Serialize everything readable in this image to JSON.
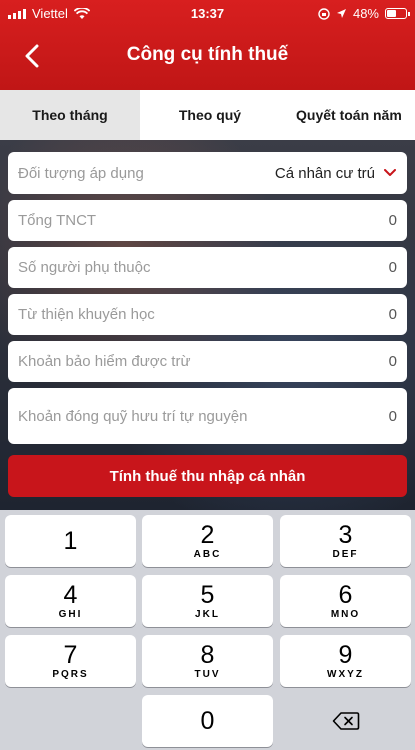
{
  "status_bar": {
    "carrier": "Viettel",
    "time": "13:37",
    "battery": "48%"
  },
  "header": {
    "title": "Công cụ tính thuế",
    "back_icon": "chevron-left-icon"
  },
  "tabs": [
    {
      "label": "Theo tháng",
      "active": true
    },
    {
      "label": "Theo quý",
      "active": false
    },
    {
      "label": "Quyết toán năm",
      "active": false
    }
  ],
  "form": {
    "applicable_subject": {
      "label": "Đối tượng áp dụng",
      "value": "Cá nhân cư trú"
    },
    "total_income": {
      "placeholder": "Tổng TNCT",
      "value": "0"
    },
    "dependents": {
      "placeholder": "Số người phụ thuộc",
      "value": "0"
    },
    "charity": {
      "placeholder": "Từ thiện khuyến học",
      "value": "0"
    },
    "insurance": {
      "placeholder": "Khoản bảo hiểm được trừ",
      "value": "0"
    },
    "pension": {
      "placeholder": "Khoản đóng quỹ hưu trí tự nguyện",
      "value": "0"
    },
    "calculate_button": "Tính thuế thu nhập cá nhân"
  },
  "colors": {
    "brand_red": "#c8151b",
    "header_red": "#d81f1f"
  },
  "keyboard": {
    "keys": [
      {
        "num": "1",
        "letters": ""
      },
      {
        "num": "2",
        "letters": "ABC"
      },
      {
        "num": "3",
        "letters": "DEF"
      },
      {
        "num": "4",
        "letters": "GHI"
      },
      {
        "num": "5",
        "letters": "JKL"
      },
      {
        "num": "6",
        "letters": "MNO"
      },
      {
        "num": "7",
        "letters": "PQRS"
      },
      {
        "num": "8",
        "letters": "TUV"
      },
      {
        "num": "9",
        "letters": "WXYZ"
      },
      {
        "num": "0",
        "letters": ""
      }
    ],
    "delete_icon": "backspace-icon"
  }
}
